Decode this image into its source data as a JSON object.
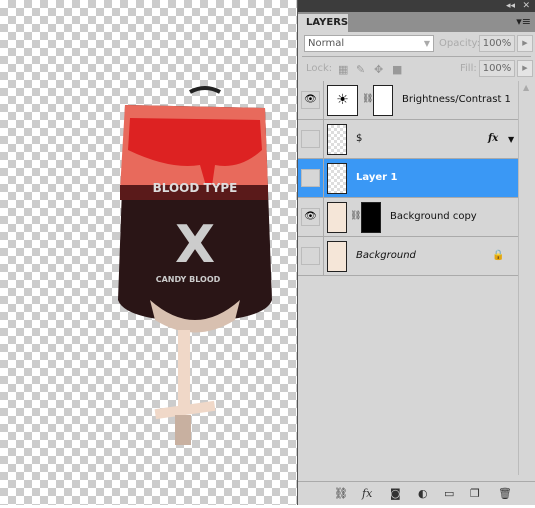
{
  "canvas": {
    "bag_text_top": "BLOOD TYPE",
    "bag_text_bottom": "CANDY BLOOD",
    "bag_symbol": "X"
  },
  "panel": {
    "collapse_icon": "◂◂",
    "close_icon": "✕",
    "tab": "LAYERS",
    "menu_icon": "▾≡",
    "blend_mode": "Normal",
    "opacity_label": "Opacity:",
    "opacity": "100%",
    "lock_label": "Lock:",
    "fill_label": "Fill:",
    "fill": "100%",
    "layers": [
      {
        "name": "Brightness/Contrast 1",
        "visible": true
      },
      {
        "name": "$",
        "visible": false,
        "fx": "fx"
      },
      {
        "name": "Layer 1",
        "visible": false,
        "selected": true
      },
      {
        "name": "Background copy",
        "visible": true
      },
      {
        "name": "Background",
        "visible": false,
        "locked": true
      }
    ],
    "accent": "#3a98f5"
  }
}
